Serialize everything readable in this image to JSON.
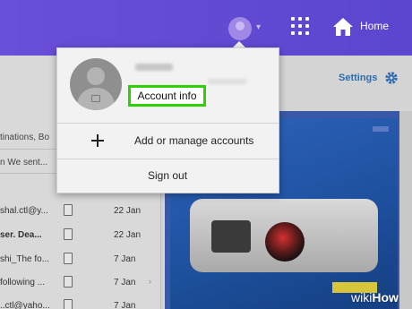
{
  "header": {
    "home_label": "Home"
  },
  "toolbar": {
    "settings_label": "Settings"
  },
  "mail": {
    "snippets": [
      "tinations, Bo",
      "n We sent..."
    ],
    "rows": [
      {
        "sender": "shal.ctl@y...",
        "date": "22 Jan"
      },
      {
        "sender": "ser.  Dea...",
        "date": "22 Jan"
      },
      {
        "sender": "shi_The fo...",
        "date": "7 Jan"
      },
      {
        "sender": "following ...",
        "date": "7 Jan"
      },
      {
        "sender": "..ctl@yaho...",
        "date": "7 Jan"
      }
    ]
  },
  "menu": {
    "account_info": "Account info",
    "add_manage": "Add or manage accounts",
    "sign_out": "Sign out"
  },
  "watermark": {
    "wiki": "wiki",
    "how": "How"
  },
  "colors": {
    "header": "#5b46cf",
    "highlight": "#2fd100",
    "link": "#2b6cb0"
  }
}
